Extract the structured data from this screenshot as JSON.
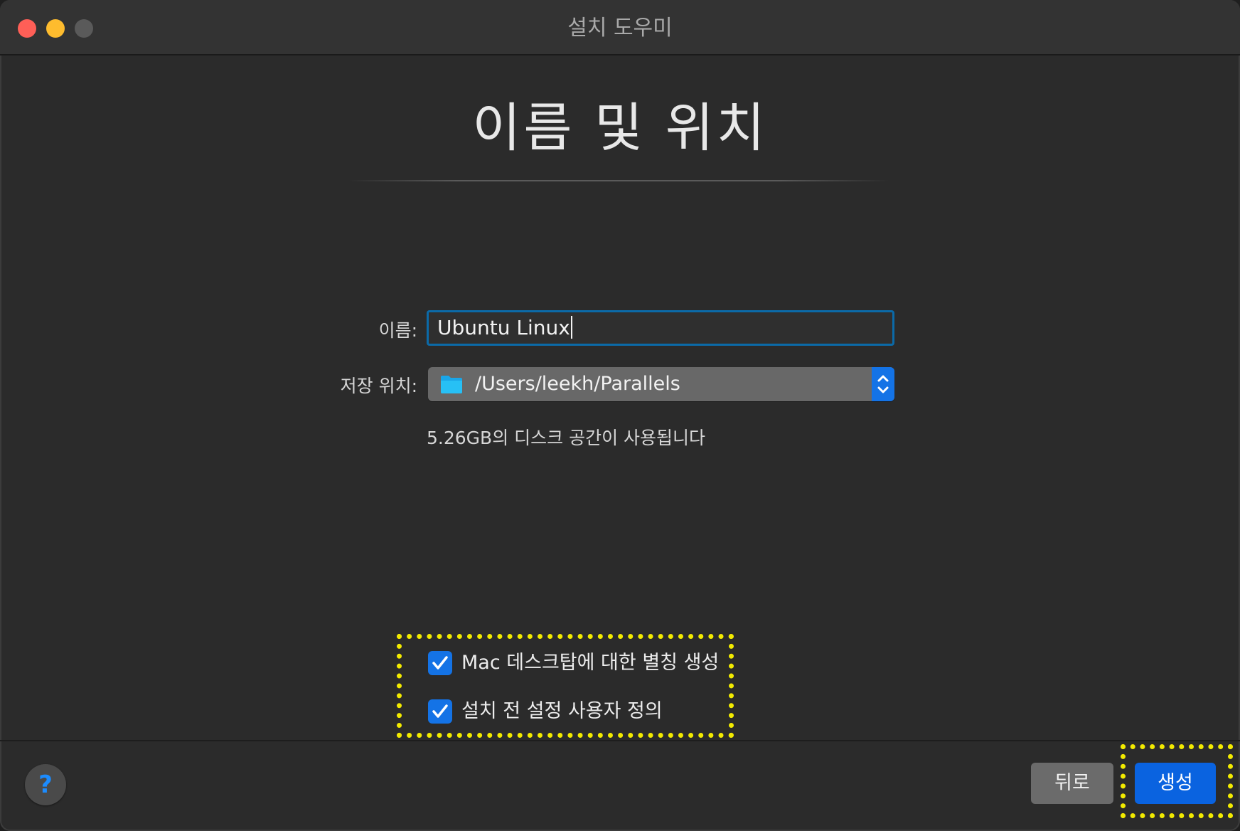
{
  "window": {
    "title": "설치 도우미"
  },
  "page": {
    "heading": "이름 및 위치"
  },
  "form": {
    "name_label": "이름:",
    "name_value": "Ubuntu Linux",
    "location_label": "저장 위치:",
    "location_value": "/Users/leekh/Parallels",
    "disk_note": "5.26GB의 디스크 공간이 사용됩니다"
  },
  "options": [
    {
      "label": "Mac 데스크탑에 대한 별칭 생성",
      "checked": true
    },
    {
      "label": "설치 전 설정 사용자 정의",
      "checked": true
    }
  ],
  "footer": {
    "help_label": "?",
    "back_label": "뒤로",
    "create_label": "생성"
  },
  "colors": {
    "accent": "#1473e6",
    "highlight": "#f2ea00",
    "window_bg": "#2b2b2b"
  },
  "icons": [
    "close-icon",
    "minimize-icon",
    "zoom-icon",
    "folder-icon",
    "stepper-icon",
    "checkmark-icon",
    "help-icon"
  ]
}
